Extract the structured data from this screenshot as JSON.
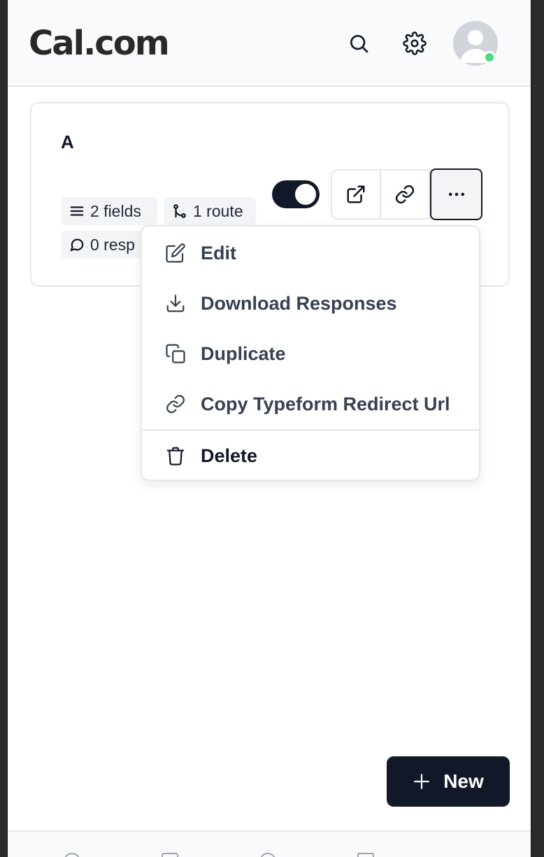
{
  "header": {
    "logo_text": "Cal.com",
    "search_icon": "search-icon",
    "settings_icon": "gear-icon",
    "avatar_status": "online"
  },
  "card": {
    "title": "A",
    "badges": {
      "fields": "2 fields",
      "route": "1 route",
      "responses": "0 resp"
    },
    "toggle_on": true
  },
  "menu": {
    "items": [
      {
        "label": "Edit",
        "icon": "edit-icon"
      },
      {
        "label": "Download Responses",
        "icon": "download-icon"
      },
      {
        "label": "Duplicate",
        "icon": "duplicate-icon"
      },
      {
        "label": "Copy Typeform Redirect Url",
        "icon": "link-icon"
      },
      {
        "label": "Delete",
        "icon": "trash-icon"
      }
    ]
  },
  "fab": {
    "label": "New"
  },
  "colors": {
    "primary": "#111827",
    "status_online": "#4ade80",
    "badge_bg": "#f3f4f6"
  }
}
